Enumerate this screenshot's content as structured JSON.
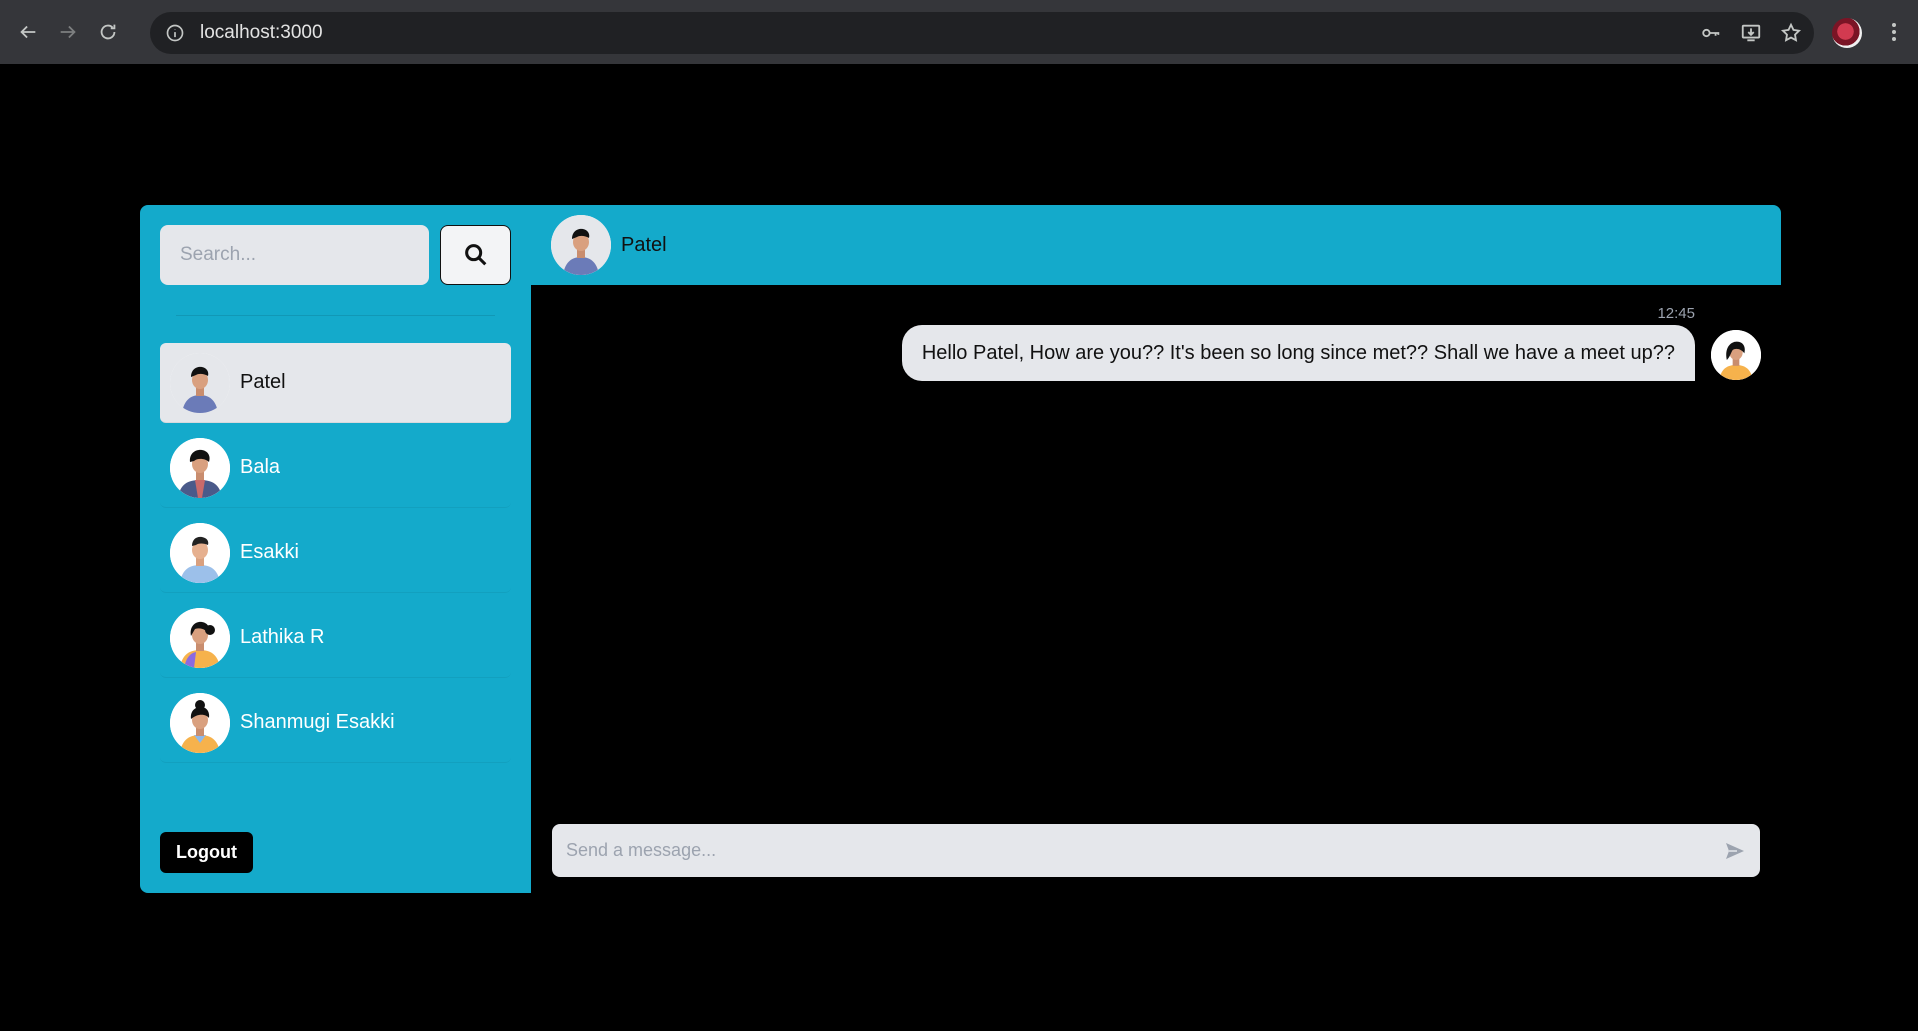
{
  "browser": {
    "url": "localhost:3000"
  },
  "sidebar": {
    "search_placeholder": "Search...",
    "contacts": [
      {
        "name": "Patel",
        "active": true
      },
      {
        "name": "Bala",
        "active": false
      },
      {
        "name": "Esakki",
        "active": false
      },
      {
        "name": "Lathika R",
        "active": false
      },
      {
        "name": "Shanmugi Esakki",
        "active": false
      }
    ],
    "logout_label": "Logout"
  },
  "chat": {
    "header_name": "Patel",
    "messages": [
      {
        "time": "12:45",
        "text": "Hello Patel, How are you?? It's been so long since met?? Shall we have a meet up??"
      }
    ],
    "composer_placeholder": "Send a message..."
  },
  "colors": {
    "accent": "#14aacb",
    "background": "#000000",
    "bubble": "#e5e7eb"
  }
}
